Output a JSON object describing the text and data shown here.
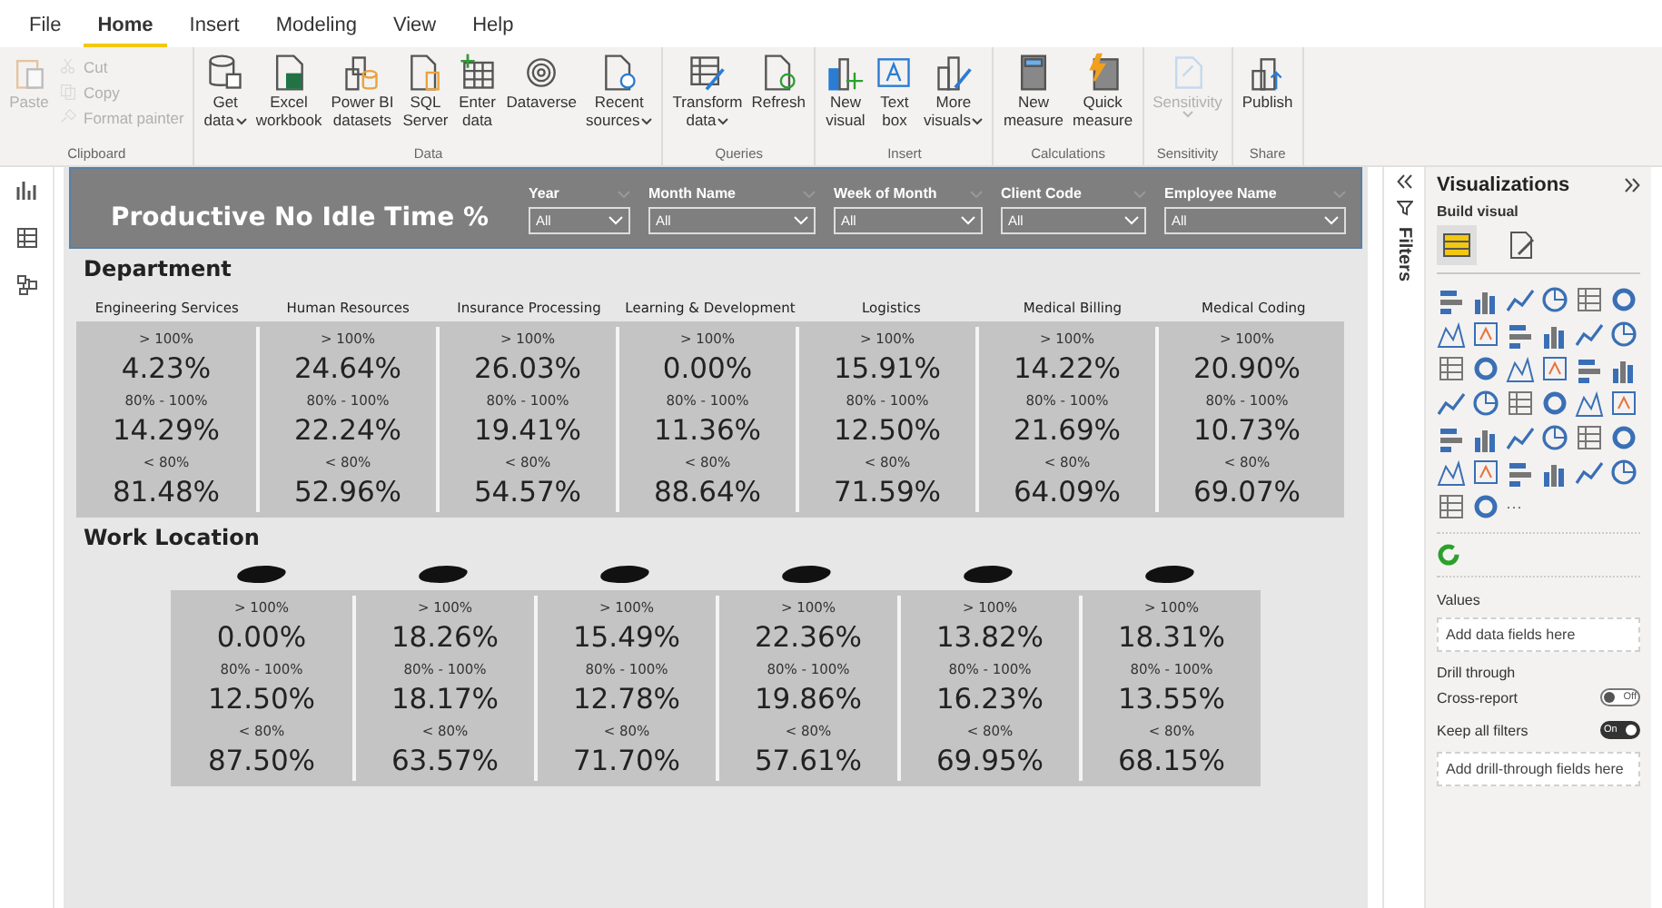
{
  "ribbon": {
    "tabs": [
      {
        "label": "File",
        "selected": false
      },
      {
        "label": "Home",
        "selected": true
      },
      {
        "label": "Insert",
        "selected": false
      },
      {
        "label": "Modeling",
        "selected": false
      },
      {
        "label": "View",
        "selected": false
      },
      {
        "label": "Help",
        "selected": false
      }
    ],
    "groups": [
      {
        "label": "Clipboard",
        "items": [
          {
            "kind": "large",
            "lines": [
              "Paste"
            ],
            "dropdown": false,
            "disabled": true
          },
          {
            "kind": "small",
            "lines": [
              "Cut"
            ],
            "dropdown": false,
            "disabled": true
          },
          {
            "kind": "small",
            "lines": [
              "Copy"
            ],
            "dropdown": false,
            "disabled": true
          },
          {
            "kind": "small",
            "lines": [
              "Format painter"
            ],
            "dropdown": false,
            "disabled": true
          }
        ]
      },
      {
        "label": "Data",
        "items": [
          {
            "kind": "large",
            "lines": [
              "Get",
              "data"
            ],
            "dropdown": true,
            "disabled": false
          },
          {
            "kind": "large",
            "lines": [
              "Excel",
              "workbook"
            ],
            "dropdown": false,
            "disabled": false
          },
          {
            "kind": "large",
            "lines": [
              "Power BI",
              "datasets"
            ],
            "dropdown": false,
            "disabled": false
          },
          {
            "kind": "large",
            "lines": [
              "SQL",
              "Server"
            ],
            "dropdown": false,
            "disabled": false
          },
          {
            "kind": "large",
            "lines": [
              "Enter",
              "data"
            ],
            "dropdown": false,
            "disabled": false
          },
          {
            "kind": "large",
            "lines": [
              "Dataverse"
            ],
            "dropdown": false,
            "disabled": false
          },
          {
            "kind": "large",
            "lines": [
              "Recent",
              "sources"
            ],
            "dropdown": true,
            "disabled": false
          }
        ]
      },
      {
        "label": "Queries",
        "items": [
          {
            "kind": "large",
            "lines": [
              "Transform",
              "data"
            ],
            "dropdown": true,
            "disabled": false
          },
          {
            "kind": "large",
            "lines": [
              "Refresh"
            ],
            "dropdown": false,
            "disabled": false
          }
        ]
      },
      {
        "label": "Insert",
        "items": [
          {
            "kind": "large",
            "lines": [
              "New",
              "visual"
            ],
            "dropdown": false,
            "disabled": false
          },
          {
            "kind": "large",
            "lines": [
              "Text",
              "box"
            ],
            "dropdown": false,
            "disabled": false
          },
          {
            "kind": "large",
            "lines": [
              "More",
              "visuals"
            ],
            "dropdown": true,
            "disabled": false
          }
        ]
      },
      {
        "label": "Calculations",
        "items": [
          {
            "kind": "large",
            "lines": [
              "New",
              "measure"
            ],
            "dropdown": false,
            "disabled": false
          },
          {
            "kind": "large",
            "lines": [
              "Quick",
              "measure"
            ],
            "dropdown": false,
            "disabled": false
          }
        ]
      },
      {
        "label": "Sensitivity",
        "items": [
          {
            "kind": "large",
            "lines": [
              "Sensitivity"
            ],
            "dropdown": true,
            "disabled": true
          }
        ]
      },
      {
        "label": "Share",
        "items": [
          {
            "kind": "large",
            "lines": [
              "Publish"
            ],
            "dropdown": false,
            "disabled": false
          }
        ]
      }
    ]
  },
  "report": {
    "title": "Productive No Idle Time %",
    "slicers": [
      {
        "label": "Year",
        "value": "All"
      },
      {
        "label": "Month Name",
        "value": "All"
      },
      {
        "label": "Week of Month",
        "value": "All"
      },
      {
        "label": "Client Code",
        "value": "All"
      },
      {
        "label": "Employee Name",
        "value": "All"
      }
    ],
    "sections": [
      {
        "title": "Department",
        "heading_redacted": false,
        "columns": [
          {
            "name": "Engineering Services",
            "bands": [
              {
                "label": "> 100%",
                "value": "4.23%"
              },
              {
                "label": "80% - 100%",
                "value": "14.29%"
              },
              {
                "label": "< 80%",
                "value": "81.48%"
              }
            ]
          },
          {
            "name": "Human Resources",
            "bands": [
              {
                "label": "> 100%",
                "value": "24.64%"
              },
              {
                "label": "80% - 100%",
                "value": "22.24%"
              },
              {
                "label": "< 80%",
                "value": "52.96%"
              }
            ]
          },
          {
            "name": "Insurance Processing",
            "bands": [
              {
                "label": "> 100%",
                "value": "26.03%"
              },
              {
                "label": "80% - 100%",
                "value": "19.41%"
              },
              {
                "label": "< 80%",
                "value": "54.57%"
              }
            ]
          },
          {
            "name": "Learning & Development",
            "bands": [
              {
                "label": "> 100%",
                "value": "0.00%"
              },
              {
                "label": "80% - 100%",
                "value": "11.36%"
              },
              {
                "label": "< 80%",
                "value": "88.64%"
              }
            ]
          },
          {
            "name": "Logistics",
            "bands": [
              {
                "label": "> 100%",
                "value": "15.91%"
              },
              {
                "label": "80% - 100%",
                "value": "12.50%"
              },
              {
                "label": "< 80%",
                "value": "71.59%"
              }
            ]
          },
          {
            "name": "Medical Billing",
            "bands": [
              {
                "label": "> 100%",
                "value": "14.22%"
              },
              {
                "label": "80% - 100%",
                "value": "21.69%"
              },
              {
                "label": "< 80%",
                "value": "64.09%"
              }
            ]
          },
          {
            "name": "Medical Coding",
            "bands": [
              {
                "label": "> 100%",
                "value": "20.90%"
              },
              {
                "label": "80% - 100%",
                "value": "10.73%"
              },
              {
                "label": "< 80%",
                "value": "69.07%"
              }
            ]
          }
        ]
      },
      {
        "title": "Work Location",
        "heading_redacted": true,
        "columns": [
          {
            "bands": [
              {
                "label": "> 100%",
                "value": "0.00%"
              },
              {
                "label": "80% - 100%",
                "value": "12.50%"
              },
              {
                "label": "< 80%",
                "value": "87.50%"
              }
            ]
          },
          {
            "bands": [
              {
                "label": "> 100%",
                "value": "18.26%"
              },
              {
                "label": "80% - 100%",
                "value": "18.17%"
              },
              {
                "label": "< 80%",
                "value": "63.57%"
              }
            ]
          },
          {
            "bands": [
              {
                "label": "> 100%",
                "value": "15.49%"
              },
              {
                "label": "80% - 100%",
                "value": "12.78%"
              },
              {
                "label": "< 80%",
                "value": "71.70%"
              }
            ]
          },
          {
            "bands": [
              {
                "label": "> 100%",
                "value": "22.36%"
              },
              {
                "label": "80% - 100%",
                "value": "19.86%"
              },
              {
                "label": "< 80%",
                "value": "57.61%"
              }
            ]
          },
          {
            "bands": [
              {
                "label": "> 100%",
                "value": "13.82%"
              },
              {
                "label": "80% - 100%",
                "value": "16.23%"
              },
              {
                "label": "< 80%",
                "value": "69.95%"
              }
            ]
          },
          {
            "bands": [
              {
                "label": "> 100%",
                "value": "18.31%"
              },
              {
                "label": "80% - 100%",
                "value": "13.55%"
              },
              {
                "label": "< 80%",
                "value": "68.15%"
              }
            ]
          }
        ]
      }
    ]
  },
  "filters_pane": {
    "label": "Filters"
  },
  "visualizations": {
    "title": "Visualizations",
    "build_label": "Build visual",
    "build_tabs": [
      {
        "selected": true
      },
      {
        "selected": false
      }
    ],
    "more_label": "···",
    "values_label": "Values",
    "values_placeholder": "Add data fields here",
    "drill_label": "Drill through",
    "toggles": [
      {
        "label": "Cross-report",
        "on": false,
        "state_text": "Off"
      },
      {
        "label": "Keep all filters",
        "on": true,
        "state_text": "On"
      }
    ],
    "drill_placeholder": "Add drill-through fields here"
  }
}
